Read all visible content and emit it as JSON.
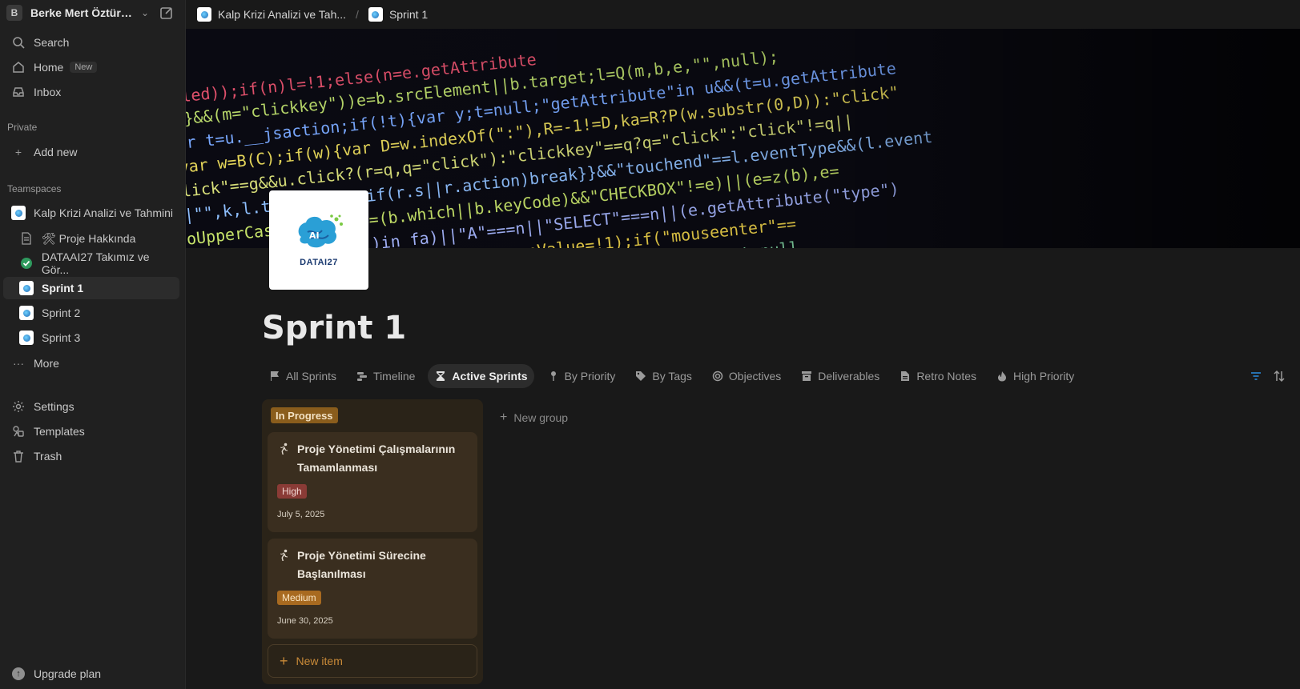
{
  "workspace": {
    "avatar_letter": "B",
    "name": "Berke Mert Öztürk..."
  },
  "sidebar": {
    "search": "Search",
    "home": "Home",
    "home_badge": "New",
    "inbox": "Inbox",
    "private_label": "Private",
    "add_new": "Add new",
    "teamspaces_label": "Teamspaces",
    "teamspace": "Kalp Krizi Analizi ve Tahmini",
    "pages": [
      {
        "label": "🛠 Proje Hakkında",
        "icon": "document-icon"
      },
      {
        "label": "DATAAI27 Takımız ve Gör...",
        "icon": "check-circle-icon"
      },
      {
        "label": "Sprint 1",
        "icon": "page-logo-icon",
        "active": true
      },
      {
        "label": "Sprint 2",
        "icon": "page-logo-icon"
      },
      {
        "label": "Sprint 3",
        "icon": "page-logo-icon"
      }
    ],
    "more": "More",
    "settings": "Settings",
    "templates": "Templates",
    "trash": "Trash",
    "upgrade": "Upgrade plan"
  },
  "breadcrumb": {
    "parent": "Kalp Krizi Analizi ve Tah...",
    "current": "Sprint 1"
  },
  "page": {
    "icon_text": "DATAI27",
    "title": "Sprint 1"
  },
  "views": [
    {
      "label": "All Sprints",
      "icon": "flag-icon"
    },
    {
      "label": "Timeline",
      "icon": "timeline-icon"
    },
    {
      "label": "Active Sprints",
      "icon": "hourglass-icon",
      "active": true
    },
    {
      "label": "By Priority",
      "icon": "pin-icon"
    },
    {
      "label": "By Tags",
      "icon": "tag-icon"
    },
    {
      "label": "Objectives",
      "icon": "target-icon"
    },
    {
      "label": "Deliverables",
      "icon": "archive-icon"
    },
    {
      "label": "Retro Notes",
      "icon": "file-icon"
    },
    {
      "label": "High Priority",
      "icon": "fire-icon"
    }
  ],
  "board": {
    "group": "In Progress",
    "cards": [
      {
        "title": "Proje Yönetimi Çalışmalarının Tamamlanması",
        "priority": "High",
        "date": "July 5, 2025"
      },
      {
        "title": "Proje Yönetimi Sürecine Başlanılması",
        "priority": "Medium",
        "date": "June 30, 2025"
      }
    ],
    "new_item": "New item",
    "new_group": "New group"
  },
  "colors": {
    "accent_blue": "#2b8ee0",
    "in_progress": "#8a5d1c",
    "high": "#8a3b36",
    "medium": "#a86a20"
  }
}
